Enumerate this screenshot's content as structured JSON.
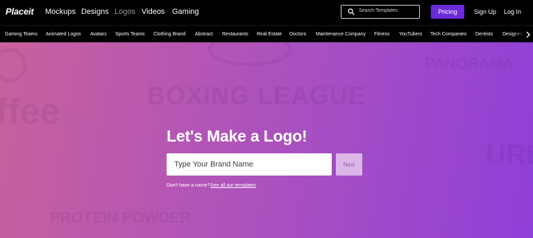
{
  "header": {
    "logo": "Placeit",
    "nav": [
      "Mockups",
      "Designs",
      "Logos",
      "Videos",
      "Gaming"
    ],
    "active_nav": "Logos",
    "search_placeholder": "Search Templates",
    "pricing_label": "Pricing",
    "signup_label": "Sign Up",
    "login_label": "Log In"
  },
  "categories": [
    "Gaming Teams",
    "Animated Logos",
    "Avatars",
    "Sports Teams",
    "Clothing Brand",
    "Abstract",
    "Restaurants",
    "Real Estate",
    "Doctors",
    "Maintenance Company",
    "Fitness",
    "YouTubers",
    "Tech Companies",
    "Dentists",
    "Designers"
  ],
  "hero": {
    "headline": "Let's Make a Logo!",
    "input_placeholder": "Type Your Brand Name",
    "next_label": "Next",
    "no_name_text": "Don't have a name?",
    "see_templates_link": "See all our templates"
  },
  "colors": {
    "accent": "#6a2bd8",
    "hero_gradient_start": "#c8629c",
    "hero_gradient_end": "#8f3ed8",
    "next_button": "#dcb6e9"
  },
  "icons": [
    "search-icon",
    "chevron-right-icon"
  ]
}
